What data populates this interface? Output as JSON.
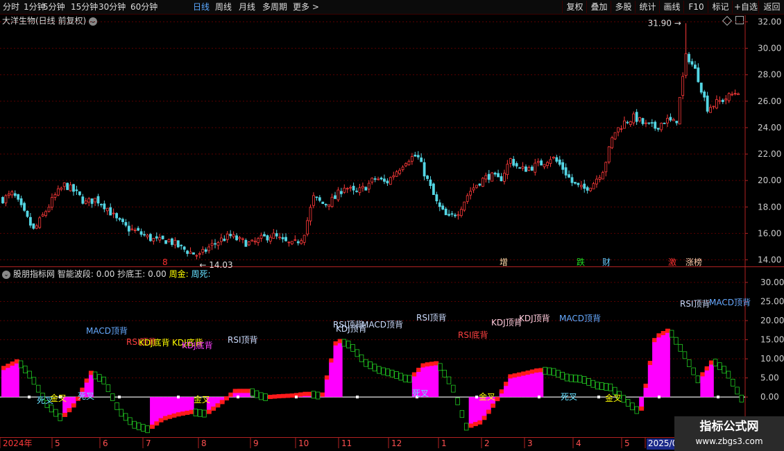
{
  "toolbar": {
    "periods": [
      "分时",
      "1分钟",
      "5分钟",
      "15分钟",
      "30分钟",
      "60分钟",
      "日线",
      "周线",
      "月线",
      "多周期",
      "更多 >"
    ],
    "active_period": "日线",
    "right_buttons": [
      "复权",
      "叠加",
      "多股",
      "统计",
      "画线",
      "F10",
      "标记",
      "+自选",
      "返回"
    ]
  },
  "main_title": "大洋生物(日线 前复权)",
  "indicator_title": {
    "name": "股朋指标网",
    "fields": "智能波段: 0.00 抄底王: 0.00",
    "gold_label": "周金:",
    "dead_label": "周死:"
  },
  "watermark": {
    "line1": "指标公式网",
    "line2": "www.zbgs3.com"
  },
  "colors": {
    "up": "#ff3a3a",
    "down": "#54d6e4",
    "grid": "#5a0000",
    "axis": "#b22222",
    "magenta": "#ff00ff",
    "green_band": "#22cc22"
  },
  "chart_data": [
    {
      "type": "candlestick",
      "y_axis_ticks": [
        14.0,
        16.0,
        18.0,
        20.0,
        22.0,
        24.0,
        26.0,
        28.0,
        30.0,
        32.0
      ],
      "ylim": [
        13.5,
        32.5
      ],
      "grid": true,
      "close_path": [
        18.6,
        19.0,
        17.6,
        16.2,
        17.5,
        18.8,
        19.7,
        19.1,
        18.3,
        18.6,
        18.0,
        17.0,
        16.4,
        16.1,
        15.7,
        15.4,
        15.5,
        15.0,
        14.6,
        14.3,
        15.0,
        15.5,
        15.8,
        15.4,
        15.2,
        15.6,
        15.9,
        15.4,
        15.1,
        15.8,
        18.7,
        18.2,
        18.6,
        19.6,
        19.0,
        19.5,
        20.2,
        19.8,
        20.7,
        21.6,
        21.9,
        20.0,
        18.1,
        17.1,
        17.7,
        19.1,
        19.9,
        20.4,
        20.0,
        21.6,
        20.8,
        21.0,
        21.3,
        21.8,
        21.0,
        19.8,
        19.3,
        19.8,
        20.9,
        23.6,
        24.4,
        24.8,
        24.2,
        24.0,
        24.6,
        24.3,
        29.6,
        28.1,
        25.5,
        25.9,
        26.3,
        26.8
      ],
      "price_labels": [
        {
          "text": "31.90",
          "value": 31.9
        },
        {
          "text": "14.03",
          "value": 14.03
        }
      ],
      "event_markers": [
        {
          "text": "8"
        },
        {
          "text": "增"
        },
        {
          "text": "跌"
        },
        {
          "text": "财"
        },
        {
          "text": "激"
        },
        {
          "text": "涨榜"
        }
      ]
    },
    {
      "type": "area",
      "y_axis_ticks": [
        0.0,
        5.0,
        10.0,
        15.0,
        20.0,
        25.0,
        30.0
      ],
      "y_tick_labels": [
        "0.00",
        "5.00",
        "10.00",
        "15.00",
        "20.00",
        "25.00",
        "30.00"
      ],
      "ylim": [
        -10.5,
        34
      ],
      "grid": true,
      "oscillator_path": [
        7.6,
        9.5,
        5.0,
        -1.8,
        -5.6,
        -1.5,
        6.4,
        4.2,
        -3.6,
        -7.2,
        -8.5,
        -5.7,
        -4.6,
        -3.9,
        -4.4,
        -1.6,
        1.6,
        1.6,
        -0.1,
        0.2,
        0.4,
        0.9,
        0.2,
        15.0,
        13.5,
        9.0,
        7.0,
        6.0,
        4.5,
        8.4,
        8.9,
        3.1,
        -7.9,
        -6.5,
        -1.2,
        5.4,
        6.2,
        7.1,
        6.6,
        5.0,
        4.7,
        3.0,
        2.5,
        -1.0,
        -4.2,
        15.6,
        17.6,
        11.5,
        4.5,
        9.6,
        6.5,
        -0.4
      ],
      "signal_labels": [
        {
          "text": "MACD顶背",
          "color": "#66aaff"
        },
        {
          "text": "RSI顶背",
          "color": "#ff4040"
        },
        {
          "text": "KDJ底背",
          "color": "#ffff00"
        },
        {
          "text": "KDJ底背",
          "color": "#ffff00"
        },
        {
          "text": "KDJ底背",
          "color": "#ff40ff"
        },
        {
          "text": "RSI顶背",
          "color": "#ccddff"
        },
        {
          "text": "RSI顶背",
          "color": "#ccddff"
        },
        {
          "text": "KDJ顶背",
          "color": "#ccddff"
        },
        {
          "text": "MACD顶背",
          "color": "#ccddff"
        },
        {
          "text": "RSI顶背",
          "color": "#ccddff"
        },
        {
          "text": "RSI底背",
          "color": "#ff4040"
        },
        {
          "text": "KDJ顶背",
          "color": "#ffccdd"
        },
        {
          "text": "KDJ顶背",
          "color": "#ffccdd"
        },
        {
          "text": "MACD顶背",
          "color": "#66aaff"
        },
        {
          "text": "RSI顶背",
          "color": "#ccddff"
        },
        {
          "text": "MACD顶背",
          "color": "#66aaff"
        }
      ],
      "cross_labels": [
        {
          "text": "死叉",
          "color": "#66e0ff"
        },
        {
          "text": "金叉",
          "color": "#ffff00"
        },
        {
          "text": "死叉",
          "color": "#66e0ff"
        },
        {
          "text": "金叉",
          "color": "#ffff00"
        },
        {
          "text": "死叉",
          "color": "#66e0ff"
        },
        {
          "text": "金叉",
          "color": "#ffff00"
        },
        {
          "text": "死叉",
          "color": "#66e0ff"
        },
        {
          "text": "金叉",
          "color": "#ffff00"
        }
      ]
    }
  ],
  "x_axis": {
    "labels": [
      "2024年",
      "5",
      "6",
      "7",
      "8",
      "9",
      "10",
      "11",
      "12",
      "1",
      "2",
      "3",
      "4",
      "5",
      "2025/0"
    ]
  }
}
